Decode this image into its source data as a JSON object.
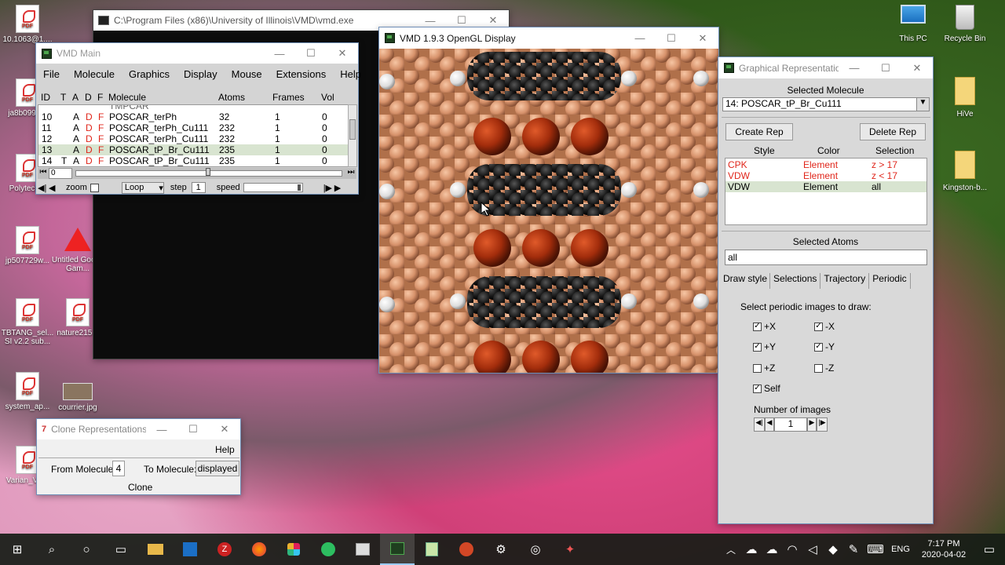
{
  "desktop_icons_left": [
    {
      "label": "10.1063@1...."
    },
    {
      "label": "ja8b0990..."
    },
    {
      "label": "Polytech..."
    },
    {
      "label": "jp507729w..."
    },
    {
      "label": "TBTANG_sel... SI v2.2 sub..."
    },
    {
      "label": "system_ap..."
    },
    {
      "label": "Varian_V2..."
    }
  ],
  "desktop_icons_mid": [
    {
      "label": "Untitled Goose Gam..."
    },
    {
      "label": "nature215..."
    },
    {
      "label": "courrier.jpg"
    }
  ],
  "desktop_icons_right": [
    {
      "label": "This PC"
    },
    {
      "label": "Recycle Bin"
    },
    {
      "label": "HiVe"
    },
    {
      "label": "Kingston-b..."
    }
  ],
  "console": {
    "title": "C:\\Program Files (x86)\\University of Illinois\\VMD\\vmd.exe"
  },
  "vmd_main": {
    "title": "VMD Main",
    "menu": [
      "File",
      "Molecule",
      "Graphics",
      "Display",
      "Mouse",
      "Extensions",
      "Help"
    ],
    "headers": [
      "ID",
      "T",
      "A",
      "D",
      "F",
      "Molecule",
      "Atoms",
      "Frames",
      "Vol"
    ],
    "partial_row": "TMPCAR",
    "rows": [
      {
        "id": "10",
        "t": "",
        "a": "A",
        "d": "D",
        "f": "F",
        "mol": "POSCAR_terPh",
        "atoms": "32",
        "frames": "1",
        "vol": "0"
      },
      {
        "id": "11",
        "t": "",
        "a": "A",
        "d": "D",
        "f": "F",
        "mol": "POSCAR_terPh_Cu111",
        "atoms": "232",
        "frames": "1",
        "vol": "0"
      },
      {
        "id": "12",
        "t": "",
        "a": "A",
        "d": "D",
        "f": "F",
        "mol": "POSCAR_terPh_Cu111",
        "atoms": "232",
        "frames": "1",
        "vol": "0"
      },
      {
        "id": "13",
        "t": "",
        "a": "A",
        "d": "D",
        "f": "F",
        "mol": "POSCAR_tP_Br_Cu111",
        "atoms": "235",
        "frames": "1",
        "vol": "0"
      },
      {
        "id": "14",
        "t": "T",
        "a": "A",
        "d": "D",
        "f": "F",
        "mol": "POSCAR_tP_Br_Cu111",
        "atoms": "235",
        "frames": "1",
        "vol": "0"
      }
    ],
    "frame_value": "0",
    "zoom_label": "zoom",
    "loop_value": "Loop",
    "step_label": "step",
    "step_value": "1",
    "speed_label": "speed"
  },
  "opengl": {
    "title": "VMD 1.9.3 OpenGL Display"
  },
  "clone": {
    "title": "Clone Representations",
    "help": "Help",
    "from_label": "From Molecule:",
    "from_value": "4",
    "to_label": "To Molecule:",
    "to_value": "displayed",
    "clone_button": "Clone"
  },
  "graph_reps": {
    "title": "Graphical Representations",
    "selected_molecule_label": "Selected Molecule",
    "selected_molecule_value": "14: POSCAR_tP_Br_Cu111",
    "create_rep": "Create Rep",
    "delete_rep": "Delete Rep",
    "col_style": "Style",
    "col_color": "Color",
    "col_selection": "Selection",
    "reps": [
      {
        "style": "CPK",
        "color": "Element",
        "selection": "z > 17"
      },
      {
        "style": "VDW",
        "color": "Element",
        "selection": "z < 17"
      },
      {
        "style": "VDW",
        "color": "Element",
        "selection": "all"
      }
    ],
    "selected_atoms_label": "Selected Atoms",
    "selected_atoms_value": "all",
    "tabs": [
      "Draw style",
      "Selections",
      "Trajectory",
      "Periodic"
    ],
    "periodic_heading": "Select periodic images to draw:",
    "periodic": [
      {
        "label": "+X",
        "checked": true
      },
      {
        "label": "-X",
        "checked": true
      },
      {
        "label": "+Y",
        "checked": true
      },
      {
        "label": "-Y",
        "checked": true
      },
      {
        "label": "+Z",
        "checked": false
      },
      {
        "label": "-Z",
        "checked": false
      },
      {
        "label": "Self",
        "checked": true
      }
    ],
    "num_images_label": "Number of images",
    "num_images_value": "1"
  },
  "taskbar": {
    "time": "7:17 PM",
    "date": "2020-04-02",
    "lang": "ENG"
  }
}
